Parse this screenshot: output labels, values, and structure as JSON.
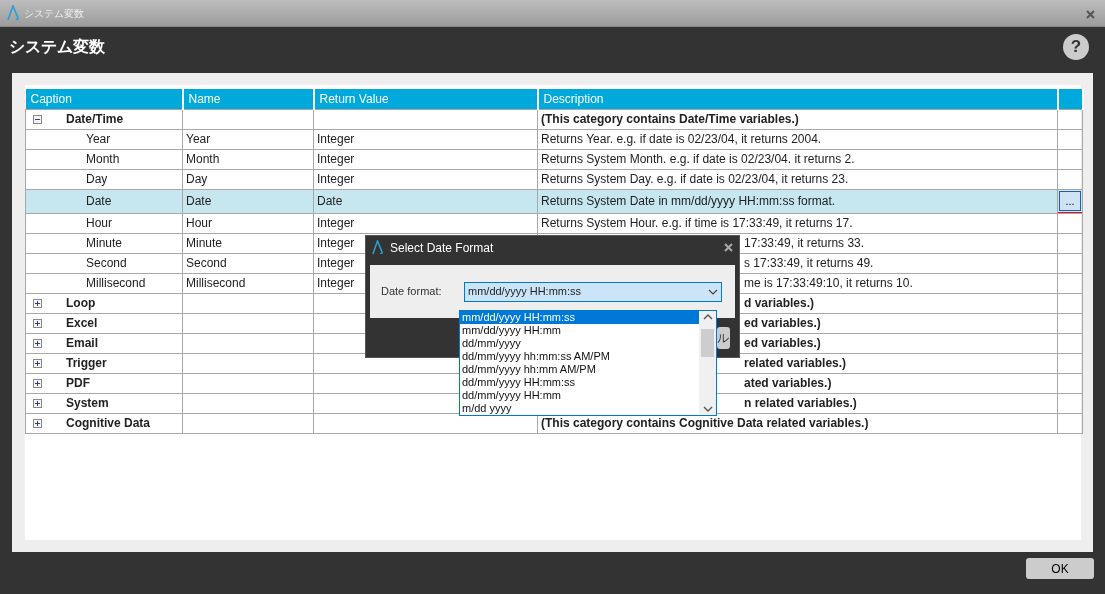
{
  "window": {
    "title": "システム変数",
    "heading": "システム変数",
    "help": "?"
  },
  "table": {
    "columns": [
      "Caption",
      "Name",
      "Return Value",
      "Description"
    ],
    "rows": [
      {
        "caption": "Date/Time",
        "expanded": true,
        "description": "(This category contains Date/Time variables.)",
        "children": [
          {
            "caption": "Year",
            "name": "Year",
            "return_value": "Integer",
            "description": "Returns Year. e.g. if date is 02/23/04, it returns 2004.",
            "selected": false
          },
          {
            "caption": "Month",
            "name": "Month",
            "return_value": "Integer",
            "description": "Returns System Month. e.g. if date is 02/23/04. it returns 2.",
            "selected": false
          },
          {
            "caption": "Day",
            "name": "Day",
            "return_value": "Integer",
            "description": "Returns System Day. e.g. if date is 02/23/04, it returns 23.",
            "selected": false
          },
          {
            "caption": "Date",
            "name": "Date",
            "return_value": "Date",
            "description": "Returns System Date in mm/dd/yyyy HH:mm:ss format.",
            "selected": true,
            "button": "..."
          },
          {
            "caption": "Hour",
            "name": "Hour",
            "return_value": "Integer",
            "description": "Returns System Hour. e.g. if time is 17:33:49, it returns 17.",
            "selected": false
          },
          {
            "caption": "Minute",
            "name": "Minute",
            "return_value": "Integer",
            "description": "17:33:49, it returns 33.",
            "selected": false,
            "covered": true
          },
          {
            "caption": "Second",
            "name": "Second",
            "return_value": "Integer",
            "description": "s 17:33:49, it returns 49.",
            "selected": false,
            "covered": true
          },
          {
            "caption": "Millisecond",
            "name": "Millisecond",
            "return_value": "Integer",
            "description": "me is 17:33:49:10, it returns 10.",
            "selected": false,
            "covered": true
          }
        ]
      },
      {
        "caption": "Loop",
        "expanded": false,
        "description": "d variables.)",
        "covered": true
      },
      {
        "caption": "Excel",
        "expanded": false,
        "description": "ed variables.)",
        "covered": true
      },
      {
        "caption": "Email",
        "expanded": false,
        "description": "ed variables.)",
        "covered": true
      },
      {
        "caption": "Trigger",
        "expanded": false,
        "description": "related variables.)",
        "covered": true
      },
      {
        "caption": "PDF",
        "expanded": false,
        "description": "ated variables.)",
        "covered": true
      },
      {
        "caption": "System",
        "expanded": false,
        "description": "n related variables.)",
        "covered": true
      },
      {
        "caption": "Cognitive Data",
        "expanded": false,
        "description": "(This category contains Cognitive Data related variables.)"
      }
    ]
  },
  "dialog": {
    "title": "Select Date Format",
    "field_label": "Date format:",
    "value": "mm/dd/yyyy HH:mm:ss",
    "button_fragment": "ル",
    "options": [
      {
        "label": "mm/dd/yyyy HH:mm:ss",
        "selected": true
      },
      {
        "label": "mm/dd/yyyy HH:mm",
        "selected": false
      },
      {
        "label": "dd/mm/yyyy",
        "selected": false
      },
      {
        "label": "dd/mm/yyyy hh:mm:ss AM/PM",
        "selected": false
      },
      {
        "label": "dd/mm/yyyy hh:mm AM/PM",
        "selected": false
      },
      {
        "label": "dd/mm/yyyy HH:mm:ss",
        "selected": false
      },
      {
        "label": "dd/mm/yyyy HH:mm",
        "selected": false
      },
      {
        "label": "m/dd yyyy",
        "selected": false
      }
    ]
  },
  "footer": {
    "ok": "OK"
  }
}
